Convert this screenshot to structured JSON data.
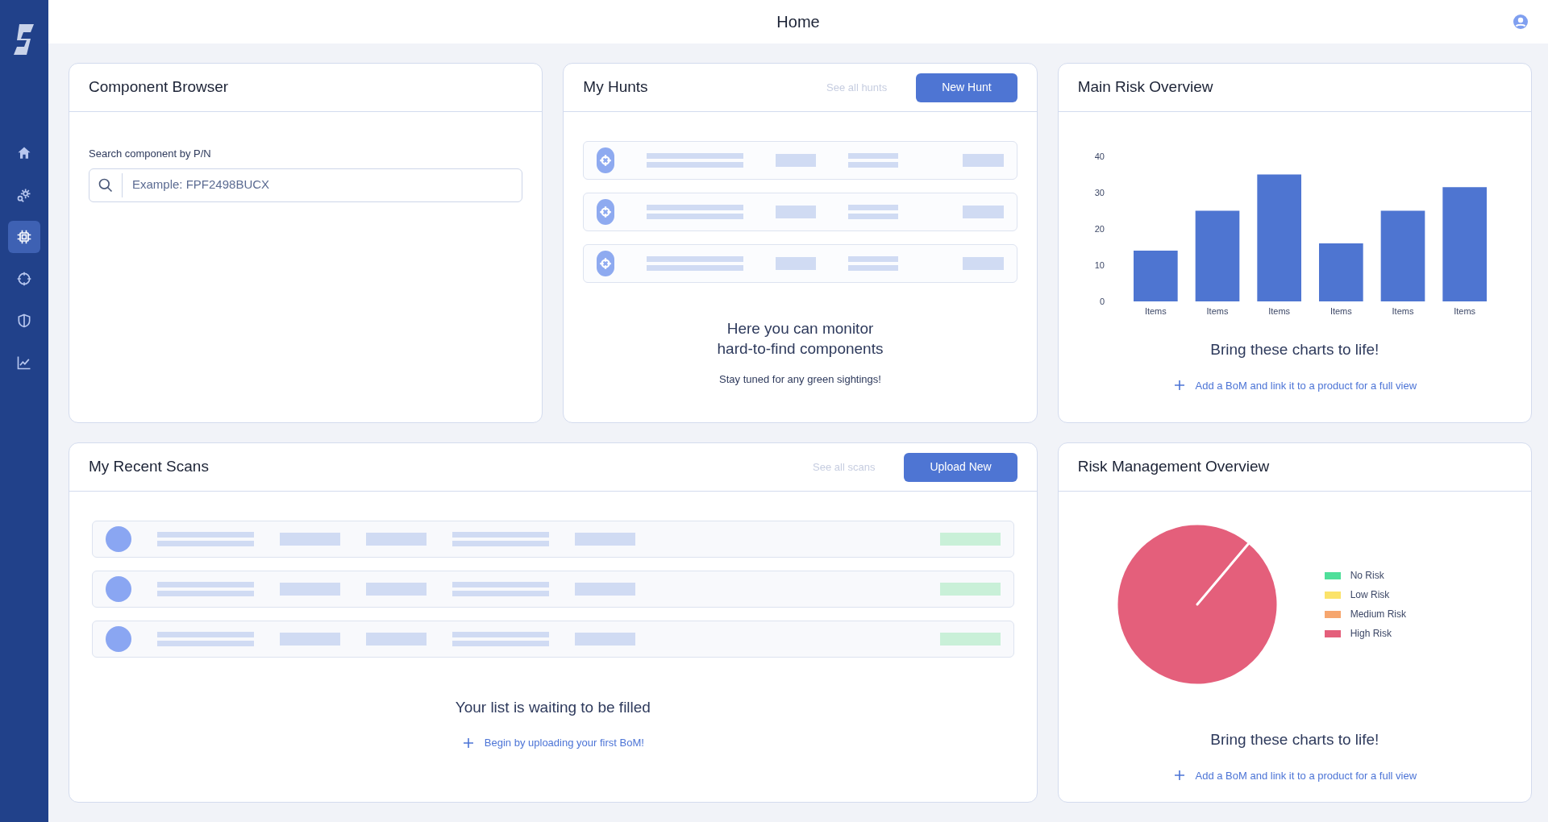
{
  "header": {
    "title": "Home"
  },
  "sidebar": {
    "items": [
      {
        "kind": "home",
        "selected": false
      },
      {
        "kind": "gear-search",
        "selected": false
      },
      {
        "kind": "chip",
        "selected": true
      },
      {
        "kind": "crosshair",
        "selected": false
      },
      {
        "kind": "shield",
        "selected": false
      },
      {
        "kind": "chart",
        "selected": false
      }
    ]
  },
  "component_browser": {
    "title": "Component Browser",
    "search_label": "Search component by P/N",
    "search": {
      "placeholder": "Example: FPF2498BUCX"
    }
  },
  "my_hunts": {
    "title": "My Hunts",
    "link": "See all hunts",
    "button": "New Hunt",
    "message": "Here you can monitor\nhard-to-find components",
    "submessage": "Stay tuned for any green sightings!"
  },
  "main_risk_overview": {
    "title": "Main Risk Overview",
    "chart_data": {
      "type": "bar",
      "categories": [
        "Items",
        "Items",
        "Items",
        "Items",
        "Items",
        "Items"
      ],
      "values": [
        14,
        25,
        35,
        16,
        25,
        31.5
      ],
      "yticks": [
        0,
        10,
        20,
        30,
        40
      ],
      "ylim": [
        0,
        40
      ]
    },
    "message": "Bring these charts to life!",
    "action": "Add a BoM and link it to a product for a full view"
  },
  "my_recent_scans": {
    "title": "My Recent Scans",
    "link": "See all scans",
    "button": "Upload New",
    "message": "Your list is waiting to be filled",
    "action": "Begin by uploading your first BoM!"
  },
  "risk_management_overview": {
    "title": "Risk Management Overview",
    "chart_data": {
      "type": "pie",
      "categories": [
        "No Risk",
        "Low Risk",
        "Medium Risk",
        "High Risk"
      ],
      "values": [
        0,
        0,
        0,
        100
      ],
      "colors": [
        "#4fdf9a",
        "#fbe36a",
        "#f6a66e",
        "#e45f7b"
      ]
    },
    "message": "Bring these charts to life!",
    "action": "Add a BoM and link it to a product for a full view"
  }
}
